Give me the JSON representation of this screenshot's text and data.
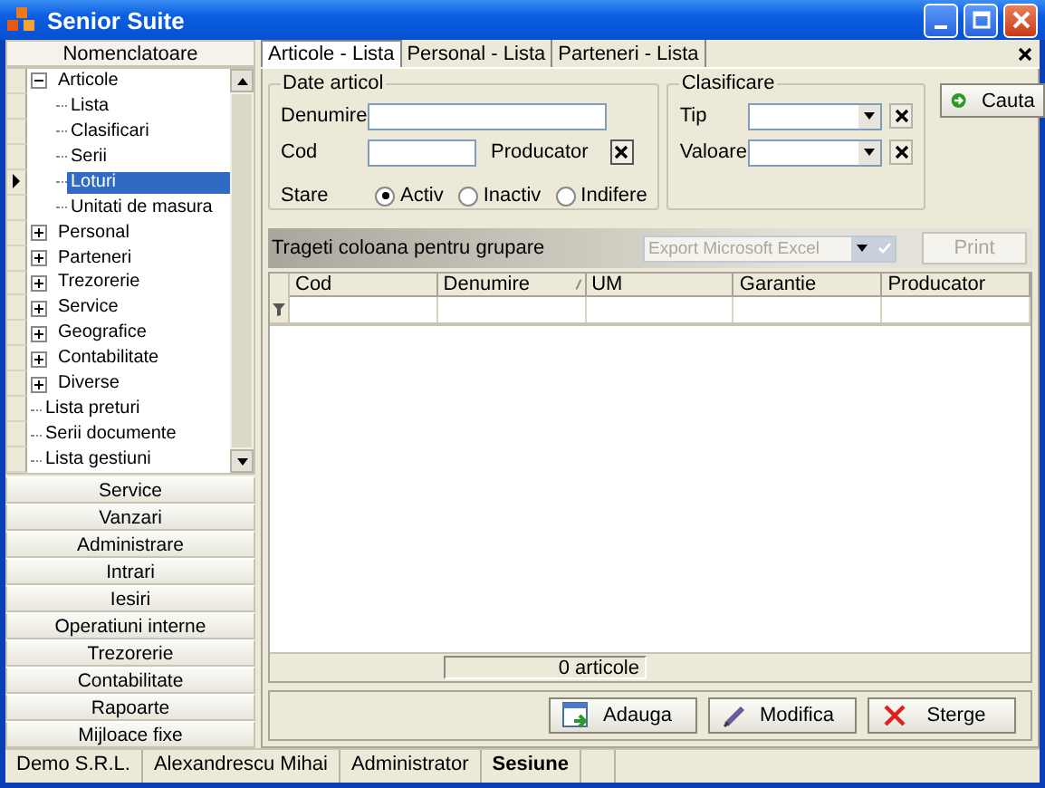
{
  "window": {
    "title": "Senior Suite"
  },
  "sidebar": {
    "header": "Nomenclatoare",
    "tree": [
      {
        "label": "Articole",
        "kind": "folder",
        "expanded": true,
        "selected": false,
        "children": [
          {
            "label": "Lista",
            "kind": "leaf",
            "selected": false
          },
          {
            "label": "Clasificari",
            "kind": "leaf",
            "selected": false
          },
          {
            "label": "Serii",
            "kind": "leaf",
            "selected": false
          },
          {
            "label": "Loturi",
            "kind": "leaf",
            "selected": true
          },
          {
            "label": "Unitati de masura",
            "kind": "leaf",
            "selected": false
          }
        ]
      },
      {
        "label": "Personal",
        "kind": "folder",
        "expanded": false,
        "selected": false
      },
      {
        "label": "Parteneri",
        "kind": "folder",
        "expanded": false,
        "selected": false
      },
      {
        "label": "Trezorerie",
        "kind": "folder",
        "expanded": false,
        "selected": false
      },
      {
        "label": "Service",
        "kind": "folder",
        "expanded": false,
        "selected": false
      },
      {
        "label": "Geografice",
        "kind": "folder",
        "expanded": false,
        "selected": false
      },
      {
        "label": "Contabilitate",
        "kind": "folder",
        "expanded": false,
        "selected": false
      },
      {
        "label": "Diverse",
        "kind": "folder",
        "expanded": false,
        "selected": false
      },
      {
        "label": "Lista preturi",
        "kind": "leaf",
        "selected": false
      },
      {
        "label": "Serii documente",
        "kind": "leaf",
        "selected": false
      },
      {
        "label": "Lista gestiuni",
        "kind": "leaf",
        "selected": false
      }
    ],
    "sections": [
      "Service",
      "Vanzari",
      "Administrare",
      "Intrari",
      "Iesiri",
      "Operatiuni interne",
      "Trezorerie",
      "Contabilitate",
      "Rapoarte",
      "Mijloace fixe"
    ]
  },
  "tabs": [
    {
      "label": "Articole - Lista",
      "selected": true
    },
    {
      "label": "Personal - Lista",
      "selected": false
    },
    {
      "label": "Parteneri - Lista",
      "selected": false
    }
  ],
  "date_articol": {
    "title": "Date articol",
    "denumire_label": "Denumire",
    "cod_label": "Cod",
    "producator_label": "Producator",
    "stare_label": "Stare",
    "stare_options": [
      {
        "label": "Activ",
        "selected": true
      },
      {
        "label": "Inactiv",
        "selected": false
      },
      {
        "label": "Indifere",
        "selected": false
      }
    ]
  },
  "clasificare": {
    "title": "Clasificare",
    "fields": [
      {
        "label": "Tip"
      },
      {
        "label": "Valoare"
      }
    ]
  },
  "search_button": "Cauta",
  "grid": {
    "group_hint": "Trageti coloana pentru grupare",
    "export": {
      "value": "Export Microsoft Excel",
      "disabled": true
    },
    "print": {
      "label": "Print",
      "disabled": true
    },
    "columns": [
      {
        "label": "Cod",
        "sorted": false
      },
      {
        "label": "Denumire",
        "sorted": true
      },
      {
        "label": "UM",
        "sorted": false
      },
      {
        "label": "Garantie",
        "sorted": false
      },
      {
        "label": "Producator",
        "sorted": false
      }
    ],
    "footer": "0 articole"
  },
  "actions": [
    {
      "label": "Adauga",
      "kind": "add"
    },
    {
      "label": "Modifica",
      "kind": "edit"
    },
    {
      "label": "Sterge",
      "kind": "delete"
    }
  ],
  "status_bar": [
    {
      "text": "Demo S.R.L.",
      "bold": false
    },
    {
      "text": "Alexandrescu Mihai",
      "bold": false
    },
    {
      "text": "Administrator",
      "bold": false
    },
    {
      "text": "Sesiune",
      "bold": true
    }
  ]
}
